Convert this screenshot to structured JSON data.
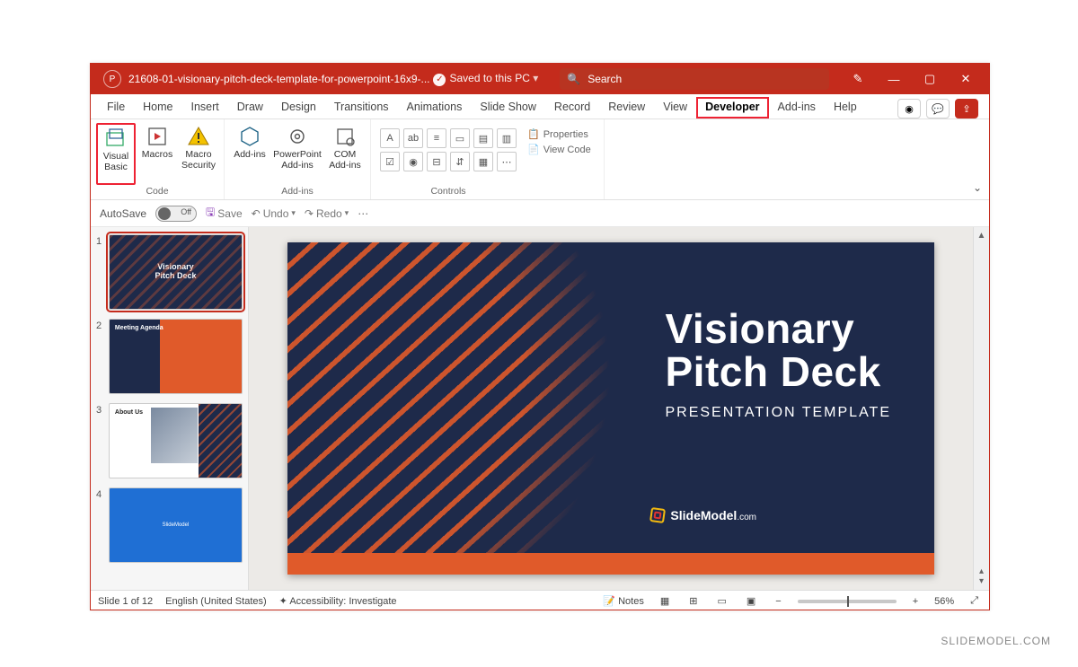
{
  "titlebar": {
    "filename": "21608-01-visionary-pitch-deck-template-for-powerpoint-16x9-...",
    "saved_status": "Saved to this PC",
    "search_placeholder": "Search"
  },
  "tabs": [
    "File",
    "Home",
    "Insert",
    "Draw",
    "Design",
    "Transitions",
    "Animations",
    "Slide Show",
    "Record",
    "Review",
    "View",
    "Developer",
    "Add-ins",
    "Help"
  ],
  "active_tab_index": 11,
  "ribbon": {
    "code": {
      "label": "Code",
      "visual_basic": "Visual Basic",
      "macros": "Macros",
      "macro_security": "Macro Security"
    },
    "addins": {
      "label": "Add-ins",
      "addins_btn": "Add-ins",
      "ppt_addins": "PowerPoint Add-ins",
      "com_addins": "COM Add-ins"
    },
    "controls": {
      "label": "Controls",
      "properties": "Properties",
      "view_code": "View Code"
    }
  },
  "qat": {
    "autosave": "AutoSave",
    "autosave_state": "Off",
    "save": "Save",
    "undo": "Undo",
    "redo": "Redo"
  },
  "thumbnails": [
    {
      "num": "1",
      "title_a": "Visionary",
      "title_b": "Pitch Deck"
    },
    {
      "num": "2",
      "title": "Meeting Agenda"
    },
    {
      "num": "3",
      "title": "About Us"
    },
    {
      "num": "4",
      "title": "SlideModel"
    }
  ],
  "slide": {
    "line1": "Visionary",
    "line2": "Pitch Deck",
    "subtitle": "PRESENTATION TEMPLATE",
    "brand": "SlideModel",
    "brand_suffix": ".com"
  },
  "statusbar": {
    "slide_pos": "Slide 1 of 12",
    "language": "English (United States)",
    "accessibility": "Accessibility: Investigate",
    "notes": "Notes",
    "zoom": "56%"
  },
  "watermark": "SLIDEMODEL.COM"
}
